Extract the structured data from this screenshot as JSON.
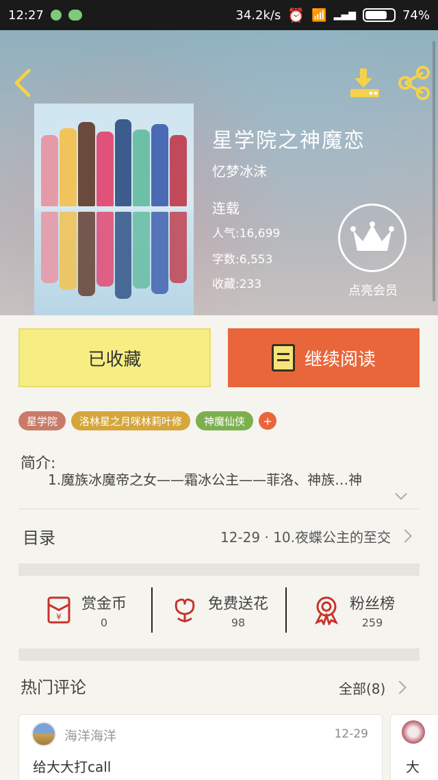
{
  "status_bar": {
    "time": "12:27",
    "network_speed": "34.2k/s",
    "battery": "74%"
  },
  "book": {
    "title": "星学院之神魔恋",
    "author": "忆梦冰沫",
    "status": "连载",
    "popularity": "人气:16,699",
    "word_count": "字数:6,553",
    "collections": "收藏:233"
  },
  "vip": {
    "label": "点亮会员"
  },
  "buttons": {
    "collected": "已收藏",
    "continue_reading": "继续阅读"
  },
  "tags": [
    {
      "label": "星学院",
      "color": "#c97b6a"
    },
    {
      "label": "洛林星之月咪林莉叶修",
      "color": "#d6a63c"
    },
    {
      "label": "神魔仙侠",
      "color": "#7cb04e"
    }
  ],
  "tag_add": "+",
  "intro": {
    "label": "简介:",
    "text": "1.魔族冰魔帝之女——霜冰公主——菲洛、神族…神"
  },
  "toc": {
    "label": "目录",
    "latest": "12-29 · 10.夜蝶公主的至交"
  },
  "actions": [
    {
      "label": "赏金币",
      "count": "0",
      "icon": "red-envelope-icon"
    },
    {
      "label": "免费送花",
      "count": "98",
      "icon": "flower-icon"
    },
    {
      "label": "粉丝榜",
      "count": "259",
      "icon": "medal-icon"
    }
  ],
  "comments_section": {
    "title": "热门评论",
    "all_label": "全部(8)"
  },
  "comments": [
    {
      "user": "海洋海洋",
      "date": "12-29",
      "body": "给大大打call"
    },
    {
      "user": "",
      "date": "",
      "body": "大"
    }
  ],
  "colors": {
    "accent_orange": "#e8663a",
    "accent_yellow": "#f6ee82",
    "icon_yellow": "#f5d24a",
    "icon_red": "#c8322b"
  }
}
